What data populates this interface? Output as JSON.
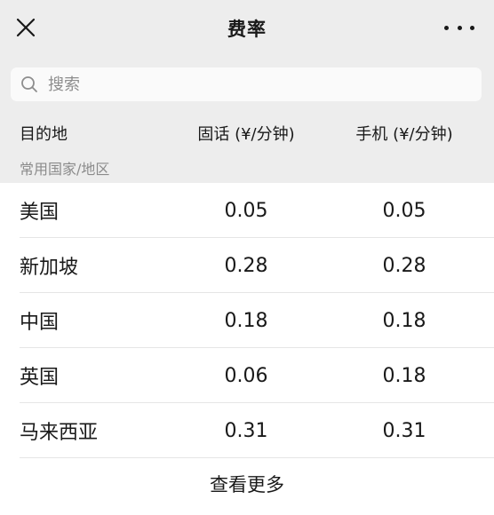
{
  "header": {
    "title": "费率"
  },
  "search": {
    "placeholder": "搜索"
  },
  "table": {
    "columns": [
      "目的地",
      "固话 (¥/分钟)",
      "手机 (¥/分钟)"
    ],
    "section_label": "常用国家/地区",
    "rows": [
      {
        "destination": "美国",
        "landline": "0.05",
        "mobile": "0.05"
      },
      {
        "destination": "新加坡",
        "landline": "0.28",
        "mobile": "0.28"
      },
      {
        "destination": "中国",
        "landline": "0.18",
        "mobile": "0.18"
      },
      {
        "destination": "英国",
        "landline": "0.06",
        "mobile": "0.18"
      },
      {
        "destination": "马来西亚",
        "landline": "0.31",
        "mobile": "0.31"
      }
    ],
    "see_more_label": "查看更多"
  },
  "icons": {
    "close": "close-icon",
    "more": "more-icon",
    "search": "search-icon"
  }
}
